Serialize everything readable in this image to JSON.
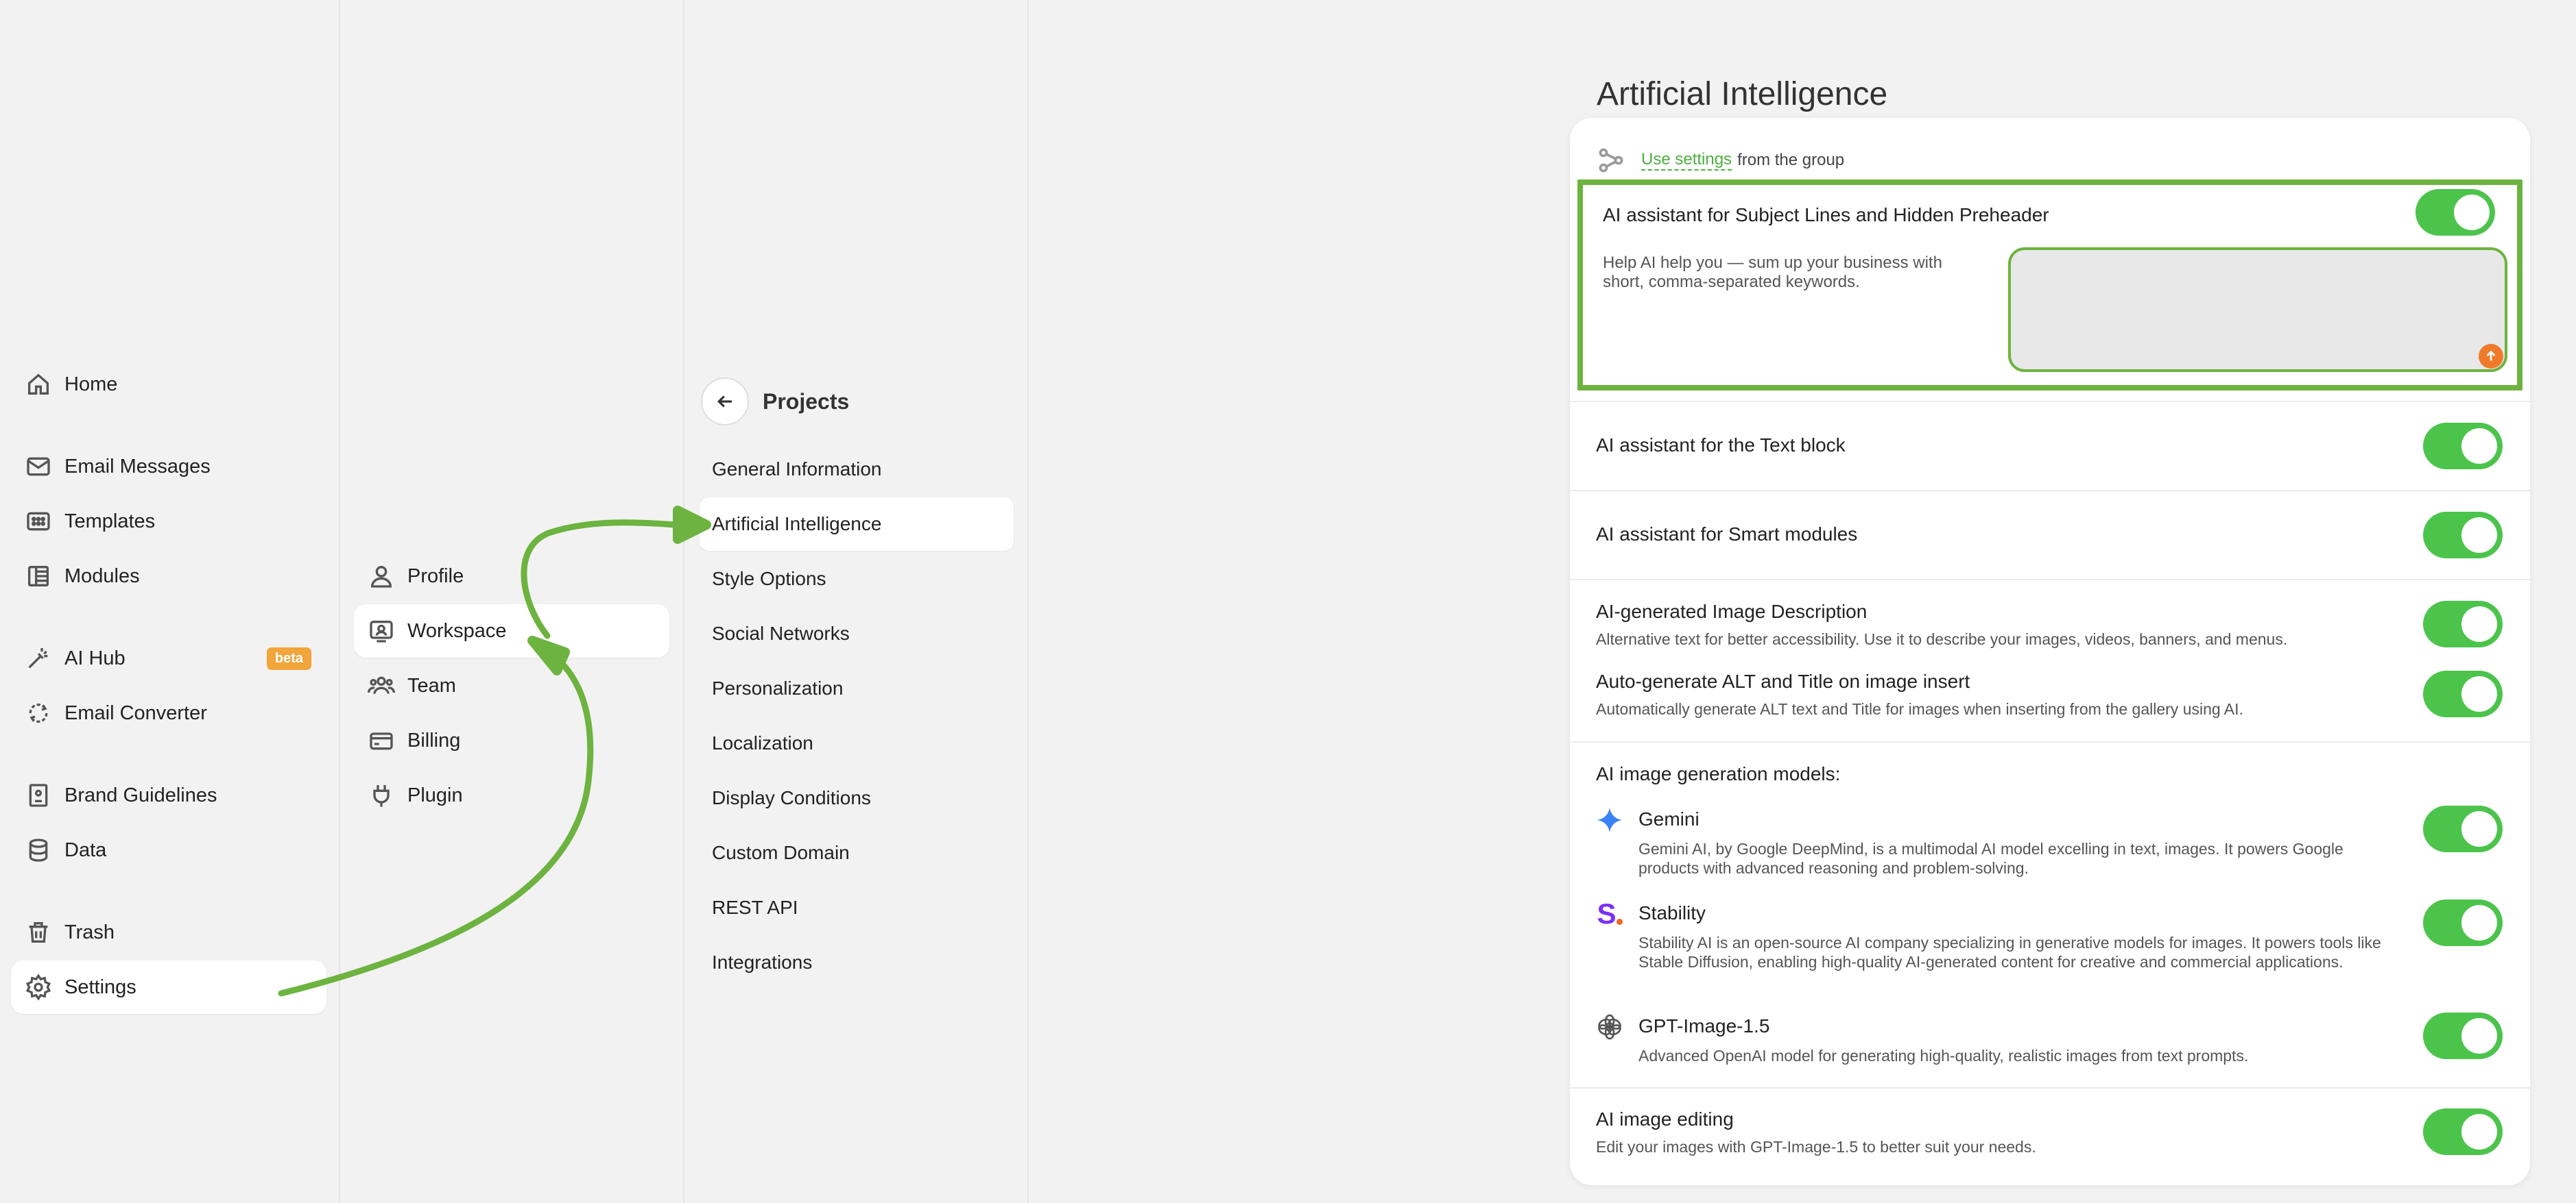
{
  "main_nav": {
    "items": [
      {
        "label": "Home",
        "icon": "home-icon"
      },
      {
        "label": "Email Messages",
        "icon": "mail-icon"
      },
      {
        "label": "Templates",
        "icon": "templates-icon"
      },
      {
        "label": "Modules",
        "icon": "modules-icon"
      },
      {
        "label": "AI Hub",
        "icon": "magic-wand-icon",
        "badge": "beta"
      },
      {
        "label": "Email Converter",
        "icon": "converter-icon"
      },
      {
        "label": "Brand Guidelines",
        "icon": "book-icon"
      },
      {
        "label": "Data",
        "icon": "database-icon"
      },
      {
        "label": "Trash",
        "icon": "trash-icon"
      },
      {
        "label": "Settings",
        "icon": "gear-icon",
        "active": true
      }
    ]
  },
  "settings_nav": {
    "items": [
      {
        "label": "Profile",
        "icon": "user-icon"
      },
      {
        "label": "Workspace",
        "icon": "workspace-icon",
        "active": true
      },
      {
        "label": "Team",
        "icon": "team-icon"
      },
      {
        "label": "Billing",
        "icon": "card-icon"
      },
      {
        "label": "Plugin",
        "icon": "plug-icon"
      }
    ]
  },
  "workspace_nav": {
    "title": "Projects",
    "items": [
      {
        "label": "General Information"
      },
      {
        "label": "Artificial Intelligence",
        "active": true
      },
      {
        "label": "Style Options"
      },
      {
        "label": "Social Networks"
      },
      {
        "label": "Personalization"
      },
      {
        "label": "Localization"
      },
      {
        "label": "Display Conditions"
      },
      {
        "label": "Custom Domain"
      },
      {
        "label": "REST API"
      },
      {
        "label": "Integrations"
      }
    ]
  },
  "content": {
    "title": "Artificial Intelligence",
    "group_link": "Use settings",
    "group_text": "from the group",
    "subject_lines": {
      "title": "AI assistant for Subject Lines and Hidden Preheader",
      "help": "Help AI help you — sum up your business with short, comma-separated keywords.",
      "value": "",
      "enabled": true
    },
    "text_block": {
      "title": "AI assistant for the Text block",
      "enabled": true
    },
    "smart_modules": {
      "title": "AI assistant for Smart modules",
      "enabled": true
    },
    "image_description": {
      "title": "AI-generated Image Description",
      "desc": "Alternative text for better accessibility. Use it to describe your images, videos, banners, and menus.",
      "enabled": true
    },
    "auto_alt": {
      "title": "Auto-generate ALT and Title on image insert",
      "desc": "Automatically generate ALT text and Title for images when inserting from the gallery using AI.",
      "enabled": true
    },
    "models_heading": "AI image generation models:",
    "models": [
      {
        "name": "Gemini",
        "desc": "Gemini AI, by Google DeepMind, is a multimodal AI model excelling in text, images. It powers Google products with advanced reasoning and problem-solving.",
        "enabled": true
      },
      {
        "name": "Stability",
        "desc": "Stability AI is an open-source AI company specializing in generative models for images. It powers tools like Stable Diffusion, enabling high-quality AI-generated content for creative and commercial applications.",
        "enabled": true
      },
      {
        "name": "GPT-Image-1.5",
        "desc": "Advanced OpenAI model for generating high-quality, realistic images from text prompts.",
        "enabled": true
      }
    ],
    "image_editing": {
      "title": "AI image editing",
      "desc": "Edit your images with GPT-Image-1.5 to better suit your needs.",
      "enabled": true
    }
  },
  "colors": {
    "accent": "#4cc44c",
    "highlight": "#6db33f",
    "beta": "#f2a53a",
    "send": "#f07a2a",
    "stability_s": "#7b2ff7",
    "stability_dot": "#f26522",
    "gemini": "#3b82f6"
  }
}
